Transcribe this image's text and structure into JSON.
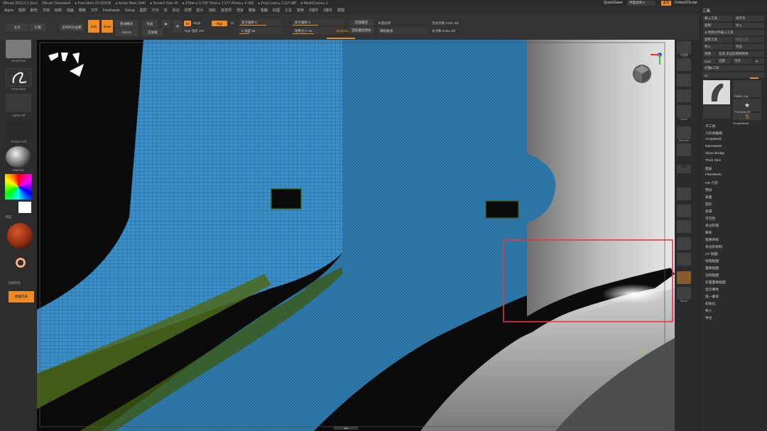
{
  "titlebar": {
    "segments": [
      "ZBrush 2023.2.1 [ricz]",
      "ZBrush Document",
      "● Free Mem 33.422GB",
      "● Active Mem 1440",
      "● Scratch Disk 45",
      "● ZTime ▸ 0.755 Timer ▸ 1.577 ATime ▸ 0.009",
      "● PolyCount ▸ 3.107 MP",
      "● MeshCount ▸ 1"
    ],
    "quick_save": "QuickSave",
    "layout_button": "界面透明 0",
    "menu_button": "菜单",
    "script_label": "DefaultZScript"
  },
  "menubar": {
    "items": [
      "Alpha",
      "笔刷",
      "颜色",
      "文档",
      "绘制",
      "动画",
      "栅格",
      "文件",
      "Freehands",
      "Group",
      "图层",
      "灯光",
      "宏",
      "标记",
      "材质",
      "影片",
      "拾取",
      "首选项",
      "渲染",
      "模板",
      "笔触",
      "纹理",
      "工具",
      "变换",
      "Z插件",
      "Z脚本",
      "帮助"
    ]
  },
  "toolbar": {
    "home": "主页",
    "lightbox": "灯箱",
    "live_boolean": "实时布尔运算",
    "edit": "Edit",
    "draw": "Draw",
    "move_mode": "移动模式",
    "paint_label": "绘画",
    "gizmo": "Gizmo",
    "mrgb": "Mrgb",
    "rgb": "Rgb",
    "m": "M",
    "zadd": "Zadd",
    "zsub": "Zsub",
    "rgb_intensity": "Rgb 强度 100",
    "focal_shift": "焦点偏移 0",
    "z_intensity": "Z 强度 25",
    "draw_size": "绘制大小 94",
    "dynamic": "Dynamic",
    "backface_mask": "背面遮罩",
    "use_surface": "使用表面",
    "active_points": "活动点数:3.061 Mil",
    "total_points": "总点数:3.061 Mil",
    "replay": "回放最后",
    "replay_rel": "回放最后相关",
    "track": "跟踪曲线",
    "polyframe_label": "实线框"
  },
  "leftshelf": {
    "brush_label": "MoveTool",
    "stroke_label": "FreeHand",
    "alpha_label": "Alpha Off",
    "texture_label": "Texture Off",
    "material_label": "MatCap",
    "gradient_label": "梯度",
    "switch_label": "切换颜色",
    "toggle_button": "换面开关",
    "toggle_label": "重置开关"
  },
  "rightdock": {
    "buttons": [
      "子选择",
      "缩放",
      "移动",
      "旋转",
      "Scroll",
      "Zoom3D",
      "Rotate",
      "透视",
      "地面",
      "Dynamic",
      "Solo",
      "PolyF",
      "Line Fill",
      "透明",
      "Xpose"
    ]
  },
  "toolpanel": {
    "header": "工具",
    "row1": [
      "载入工具",
      "另存为"
    ],
    "row2": [
      "复制",
      "导入",
      "导出"
    ],
    "row3": "从项目文件载入工具",
    "row4": [
      "复制工具",
      "粘贴工具"
    ],
    "row5": [
      "导入",
      "导出"
    ],
    "row6": [
      "克隆",
      "生成 多边形网格物体"
    ],
    "row7": [
      "GoZ",
      "全部",
      "可见",
      "R"
    ],
    "lightbox_tools": "灯箱▸工具",
    "current_tool": "41",
    "r_label": "R",
    "thumbs": [
      "PM3D_Cyl",
      "PolyMesh3D",
      "SimpleBrush"
    ],
    "subpanels": [
      "子工具",
      "几何体编辑",
      "ArrayMesh",
      "NanoMesh",
      "Slime Bridge",
      "Thick Skin",
      "图层",
      "FiberMesh",
      "HD 几何",
      "预览",
      "表面",
      "变形",
      "遮罩",
      "可见性",
      "多边形组",
      "联系",
      "变换目标",
      "多边形绘制",
      "UV 贴图",
      "纹理贴图",
      "置换贴图",
      "法线贴图",
      "矢量置换贴图",
      "显示属性",
      "统一蒙皮",
      "初始化",
      "导入",
      "导出"
    ]
  },
  "viewport": {
    "selection_color": "#e23a3a",
    "mesh_color": "#3a8fc8",
    "accent": "#f08a24"
  },
  "bottom": {
    "handle": "▴▴▴"
  }
}
